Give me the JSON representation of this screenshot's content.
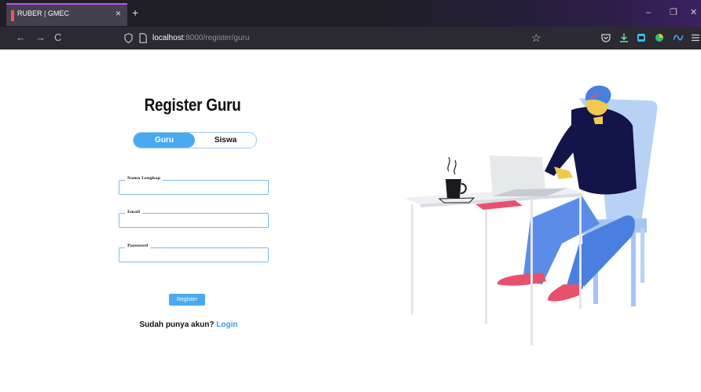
{
  "browser": {
    "tab_title": "RUBER | GMEC",
    "tab_close": "×",
    "new_tab": "+",
    "url_host": "localhost",
    "url_rest": ":8000/register/guru",
    "back": "←",
    "forward": "→",
    "reload": "C",
    "minimize": "–",
    "restore": "❐",
    "close": "✕",
    "bookmark": "☆"
  },
  "page": {
    "title": "Register Guru",
    "toggle": {
      "active": "Guru",
      "inactive": "Siswa"
    },
    "fields": [
      {
        "label": "Nama Lengkap",
        "value": ""
      },
      {
        "label": "Email",
        "value": ""
      },
      {
        "label": "Password",
        "value": ""
      }
    ],
    "register_button": "Register",
    "login_prompt": "Sudah punya akun?",
    "login_link": "Login"
  },
  "colors": {
    "accent": "#4aaaf0",
    "link": "#3b9be6"
  }
}
